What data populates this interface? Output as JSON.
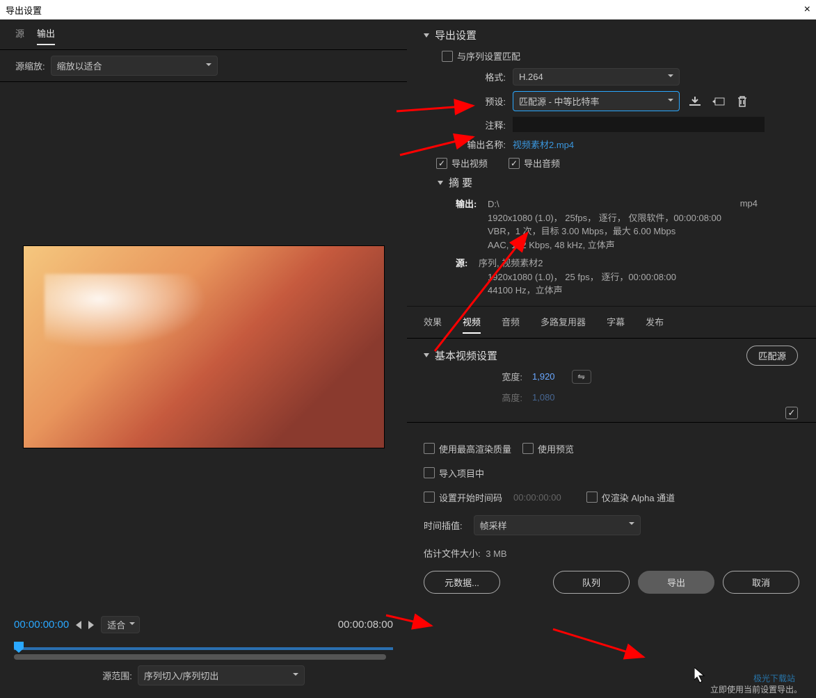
{
  "window": {
    "title": "导出设置",
    "close": "×"
  },
  "left": {
    "tabs": {
      "src": "源",
      "output": "输出"
    },
    "scale_label": "源缩放:",
    "scale_value": "缩放以适合",
    "time_start": "00:00:00:00",
    "time_end": "00:00:08:00",
    "fit_label": "适合",
    "range_label": "源范围:",
    "range_value": "序列切入/序列切出"
  },
  "settings": {
    "title": "导出设置",
    "match_seq": "与序列设置匹配",
    "format_label": "格式:",
    "format_value": "H.264",
    "preset_label": "预设:",
    "preset_value": "匹配源 - 中等比特率",
    "comment_label": "注释:",
    "outname_label": "输出名称:",
    "outname_value": "视频素材2.mp4",
    "export_video": "导出视频",
    "export_audio": "导出音频",
    "summary_title": "摘 要",
    "out_label": "输出:",
    "out_path": "D:\\",
    "out_ext": "mp4",
    "out_line1": "1920x1080 (1.0)， 25fps， 逐行， 仅限软件，00:00:08:00",
    "out_line2": "VBR，1 次，目标 3.00 Mbps，最大 6.00 Mbps",
    "out_line3": "AAC, 192 Kbps, 48  kHz, 立体声",
    "src_label": "源:",
    "src_line0": "序列, 视频素材2",
    "src_line1": "1920x1080 (1.0)， 25 fps， 逐行，00:00:08:00",
    "src_line2": "44100 Hz，立体声"
  },
  "mux_tabs": {
    "fx": "效果",
    "video": "视频",
    "audio": "音频",
    "mux": "多路复用器",
    "cc": "字幕",
    "publish": "发布"
  },
  "video": {
    "title": "基本视频设置",
    "match_source": "匹配源",
    "width_label": "宽度:",
    "width_value": "1,920",
    "height_label": "高度:",
    "height_value": "1,080"
  },
  "lower": {
    "max_quality": "使用最高渲染质量",
    "use_preview": "使用预览",
    "import_proj": "导入项目中",
    "start_tc": "设置开始时间码",
    "start_tc_value": "00:00:00:00",
    "alpha_only": "仅渲染 Alpha 通道",
    "interp_label": "时间插值:",
    "interp_value": "帧采样",
    "est_label": "估计文件大小:",
    "est_value": "3 MB",
    "metadata": "元数据...",
    "queue": "队列",
    "export": "导出",
    "cancel": "取消",
    "hint": "立即使用当前设置导出。"
  },
  "watermark": "极光下载站"
}
